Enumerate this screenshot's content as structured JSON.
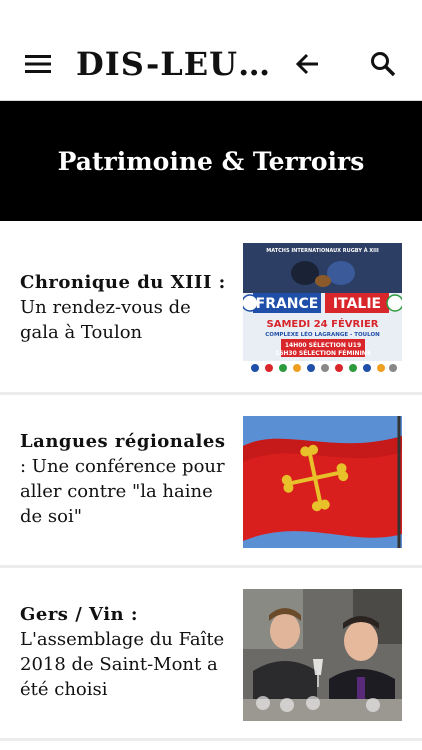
{
  "header": {
    "logo_text": "DIS-LEU…",
    "menu_icon": "hamburger-menu-icon",
    "back_icon": "arrow-left-icon",
    "search_icon": "search-icon"
  },
  "section": {
    "title": "Patrimoine & Terroirs"
  },
  "articles": [
    {
      "category": "Chronique du XIII :",
      "title": "Un rendez-vous de gala à Toulon",
      "image": {
        "top_text": "MATCHS INTERNATIONAUX RUGBY À XIII",
        "team_a": "FRANCE",
        "team_b": "ITALIE",
        "date": "SAMEDI 24 FÉVRIER",
        "venue": "COMPLEXE LÉO LAGRANGE - TOULON",
        "line1": "14H00 SÉLECTION U19",
        "line2": "15H30 SÉLECTION FÉMININE"
      }
    },
    {
      "category": "Langues régionales",
      "title": ": Une conférence pour aller contre \"la haine de soi\""
    },
    {
      "category": "Gers / Vin :",
      "title": "L'assemblage du Faîte 2018 de Saint-Mont a été choisi"
    }
  ],
  "colors": {
    "banner_bg": "#000000",
    "banner_text": "#ffffff",
    "divider": "#ececec",
    "poster_blue": "#1f4fa8",
    "poster_red": "#d8262b",
    "flag_red": "#d91e1e",
    "cross_gold": "#e8c02a"
  }
}
